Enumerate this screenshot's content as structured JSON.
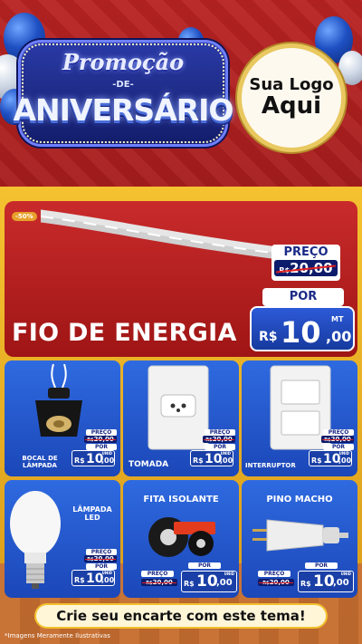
{
  "header": {
    "promo": "Promoção",
    "de": "-DE-",
    "aniversario": "ANIVERSÁRIO",
    "logo_line1": "Sua Logo",
    "logo_line2": "Aqui"
  },
  "hero": {
    "discount_tag": "-50%",
    "title": "FIO DE ENERGIA",
    "preco_label": "PREÇO",
    "old_currency": "R$",
    "old_price": "20,00",
    "por_label": "POR",
    "new_currency": "R$",
    "new_price_int": "10",
    "new_price_dec": ",00",
    "unit": "MT"
  },
  "products": [
    {
      "name": "BOCAL DE LÂMPADA",
      "preco": "PREÇO",
      "old": "20,00",
      "por": "POR",
      "rs": "R$",
      "int": "10",
      "dec": ",00",
      "unit": "UNID"
    },
    {
      "name": "TOMADA",
      "preco": "PREÇO",
      "old": "20,00",
      "por": "POR",
      "rs": "R$",
      "int": "10",
      "dec": ",00",
      "unit": "UNID"
    },
    {
      "name": "INTERRUPTOR",
      "preco": "PREÇO",
      "old": "20,00",
      "por": "POR",
      "rs": "R$",
      "int": "10",
      "dec": ",00",
      "unit": "UNID"
    },
    {
      "name": "LÂMPADA LED",
      "preco": "PREÇO",
      "old": "20,00",
      "por": "POR",
      "rs": "R$",
      "int": "10",
      "dec": ",00",
      "unit": "UNID"
    },
    {
      "name": "FITA ISOLANTE",
      "preco": "PREÇO",
      "old": "20,00",
      "por": "POR",
      "rs": "R$",
      "int": "10",
      "dec": ",00",
      "unit": "UNID"
    },
    {
      "name": "PINO MACHO",
      "preco": "PREÇO",
      "old": "20,00",
      "por": "POR",
      "rs": "R$",
      "int": "10",
      "dec": ",00",
      "unit": "UNID"
    }
  ],
  "cta": "Crie seu encarte com este tema!",
  "disclaimer": "*Imagens Meramente Ilustrativas",
  "colors": {
    "primary_blue": "#1b47b8",
    "red": "#b82323",
    "gold": "#f2c12e"
  }
}
